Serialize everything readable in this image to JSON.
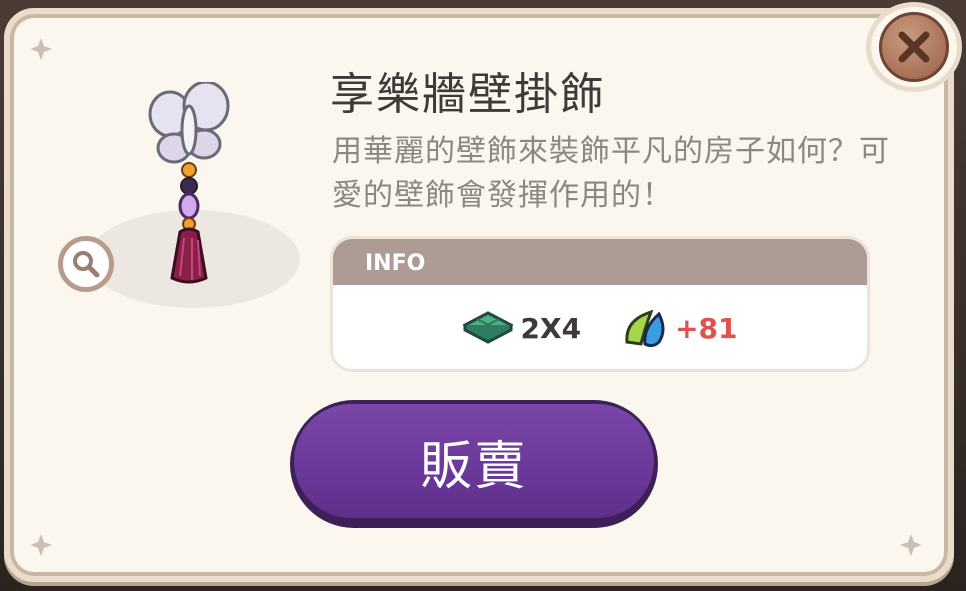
{
  "item": {
    "name": "享樂牆壁掛飾",
    "description": "用華麗的壁飾來裝飾平凡的房子如何？可愛的壁飾會發揮作用的！"
  },
  "info": {
    "header": "INFO",
    "size": "2X4",
    "size_icon": "floor-tile-icon",
    "bonus": "+81",
    "bonus_icon": "leaf-drop-icon"
  },
  "actions": {
    "sell_label": "販賣"
  },
  "colors": {
    "panel": "#fbf6ee",
    "sell_button": "#6a389a",
    "close_button": "#a77257",
    "bonus_text": "#e0524b"
  }
}
